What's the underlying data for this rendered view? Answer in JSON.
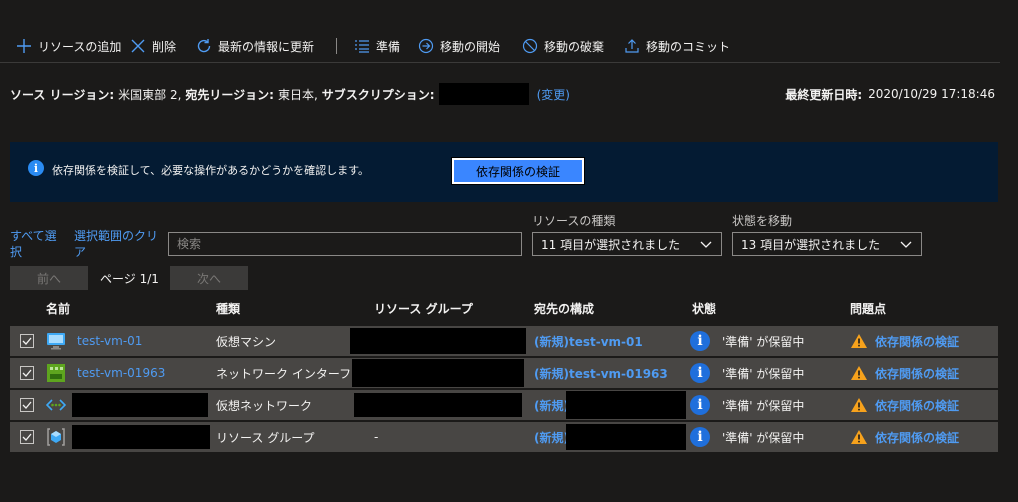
{
  "toolbar": {
    "add": "リソースの追加",
    "delete": "削除",
    "refresh": "最新の情報に更新",
    "prepare": "準備",
    "initiate": "移動の開始",
    "discard": "移動の破棄",
    "commit": "移動のコミット"
  },
  "info": {
    "source_label": "ソース リージョン:",
    "source_value": "米国東部 2,",
    "target_label": "宛先リージョン:",
    "target_value": "東日本,",
    "subscription_label": "サブスクリプション:",
    "change_link": "(変更)",
    "last_updated_label": "最終更新日時:",
    "last_updated_value": "2020/10/29 17:18:46"
  },
  "banner": {
    "message": "依存関係を検証して、必要な操作があるかどうかを確認します。",
    "button": "依存関係の検証"
  },
  "filters": {
    "select_all": "すべて選択",
    "clear_selection": "選択範囲のクリア",
    "search_placeholder": "検索",
    "resource_type_label": "リソースの種類",
    "resource_type_value": "11 項目が選択されました",
    "move_state_label": "状態を移動",
    "move_state_value": "13 項目が選択されました"
  },
  "pagination": {
    "prev": "前へ",
    "page": "ページ 1/1",
    "next": "次へ"
  },
  "table": {
    "headers": {
      "name": "名前",
      "type": "種類",
      "resource_group": "リソース グループ",
      "target_config": "宛先の構成",
      "state": "状態",
      "issues": "問題点"
    },
    "rows": [
      {
        "name": "test-vm-01",
        "type": "仮想マシン",
        "resource_group": "",
        "target": "(新規)test-vm-01",
        "state": "'準備' が保留中",
        "issue": "依存関係の検証",
        "icon": "virtual-machine-icon"
      },
      {
        "name": "test-vm-01963",
        "type": "ネットワーク インターフェイス",
        "resource_group": "",
        "target": "(新規)test-vm-01963",
        "state": "'準備' が保留中",
        "issue": "依存関係の検証",
        "icon": "network-interface-icon"
      },
      {
        "name": "",
        "type": "仮想ネットワーク",
        "resource_group": "",
        "target": "(新規)",
        "state": "'準備' が保留中",
        "issue": "依存関係の検証",
        "icon": "virtual-network-icon"
      },
      {
        "name": "",
        "type": "リソース グループ",
        "resource_group": "-",
        "target": "(新規)",
        "state": "'準備' が保留中",
        "issue": "依存関係の検証",
        "icon": "resource-group-icon"
      }
    ]
  },
  "colors": {
    "accent": "#4f9bf2",
    "banner_bg": "#041b33",
    "row_bg": "#484644",
    "warning": "#f7a21c",
    "info": "#1f6fdc"
  }
}
